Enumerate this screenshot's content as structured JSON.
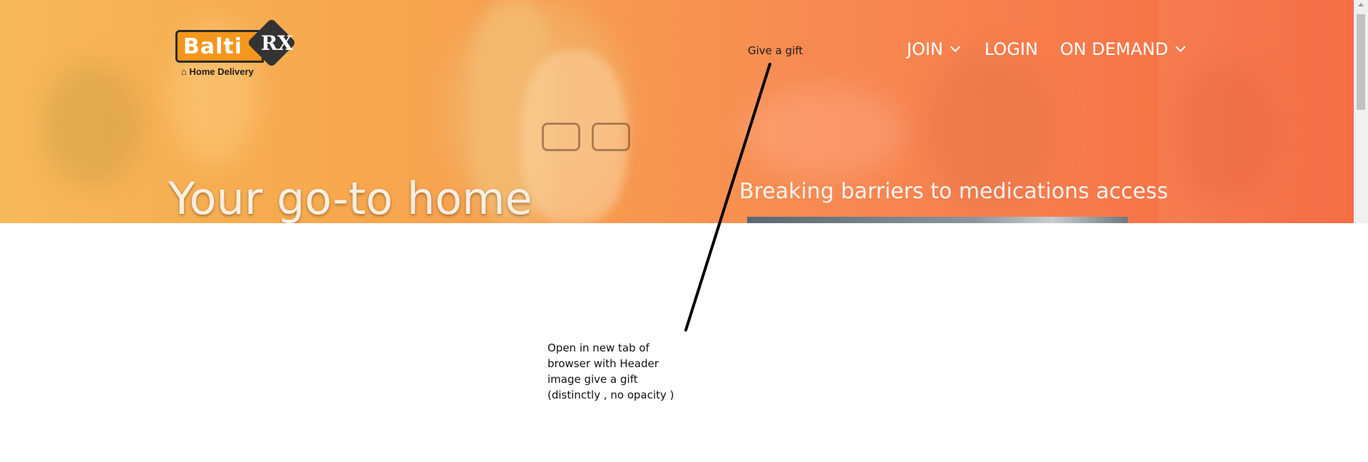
{
  "logo": {
    "brand_text": "Balti",
    "rx_text": "RX",
    "tagline": "Home Delivery",
    "brand_color": "#f5961d",
    "house_icon": "home-icon"
  },
  "nav": {
    "give_gift": "Give a gift",
    "join": "JOIN",
    "login": "LOGIN",
    "on_demand": "ON DEMAND",
    "chevron_icon": "chevron-down-icon"
  },
  "hero": {
    "title": "Your go-to home",
    "subtitle": "Breaking barriers to medications access",
    "gradient_colors": [
      "#f6b95a",
      "#f78a52",
      "#f4653a"
    ]
  },
  "annotation": {
    "lines": [
      "Open in new tab of",
      "browser  with Header",
      "image give a gift",
      "(distinctly , no opacity )"
    ]
  }
}
